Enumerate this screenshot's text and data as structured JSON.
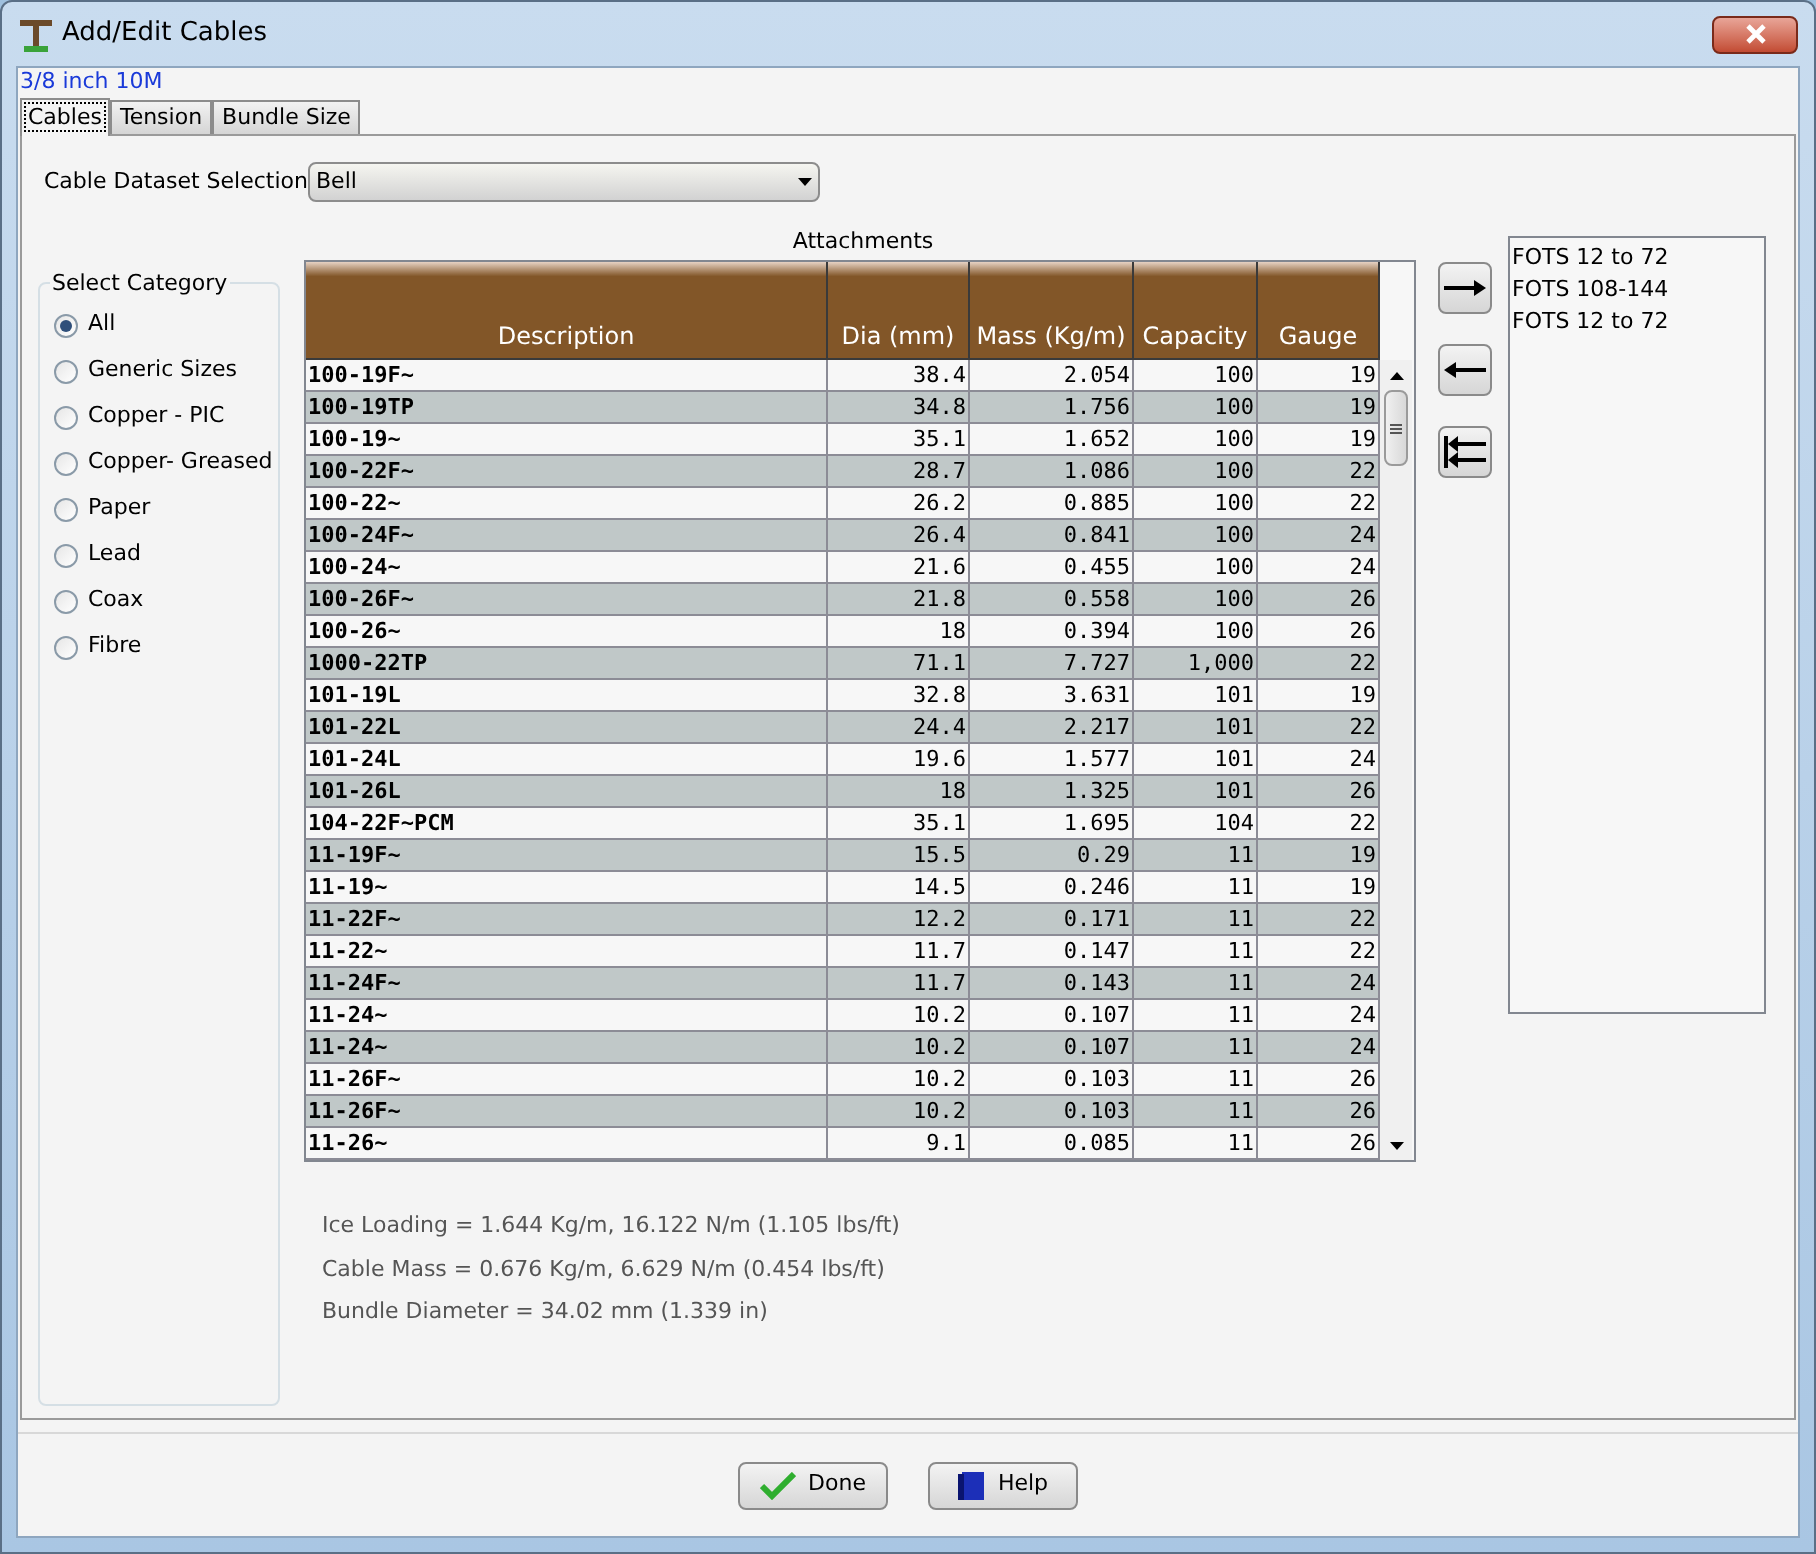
{
  "window": {
    "title": "Add/Edit Cables",
    "subtitle": "3/8 inch 10M"
  },
  "tabs": [
    {
      "label": "Cables",
      "selected": true
    },
    {
      "label": "Tension",
      "selected": false
    },
    {
      "label": "Bundle Size",
      "selected": false
    }
  ],
  "dataset": {
    "label": "Cable Dataset Selection",
    "value": "Bell"
  },
  "attachments_label": "Attachments",
  "category": {
    "title": "Select Category",
    "options": [
      {
        "label": "All",
        "selected": true
      },
      {
        "label": "Generic Sizes",
        "selected": false
      },
      {
        "label": "Copper - PIC",
        "selected": false
      },
      {
        "label": "Copper- Greased",
        "selected": false
      },
      {
        "label": "Paper",
        "selected": false
      },
      {
        "label": "Lead",
        "selected": false
      },
      {
        "label": "Coax",
        "selected": false
      },
      {
        "label": "Fibre",
        "selected": false
      }
    ]
  },
  "table": {
    "columns": [
      "Description",
      "Dia (mm)",
      "Mass (Kg/m)",
      "Capacity",
      "Gauge"
    ],
    "rows": [
      [
        "100-19F~",
        "38.4",
        "2.054",
        "100",
        "19"
      ],
      [
        "100-19TP",
        "34.8",
        "1.756",
        "100",
        "19"
      ],
      [
        "100-19~",
        "35.1",
        "1.652",
        "100",
        "19"
      ],
      [
        "100-22F~",
        "28.7",
        "1.086",
        "100",
        "22"
      ],
      [
        "100-22~",
        "26.2",
        "0.885",
        "100",
        "22"
      ],
      [
        "100-24F~",
        "26.4",
        "0.841",
        "100",
        "24"
      ],
      [
        "100-24~",
        "21.6",
        "0.455",
        "100",
        "24"
      ],
      [
        "100-26F~",
        "21.8",
        "0.558",
        "100",
        "26"
      ],
      [
        "100-26~",
        "18",
        "0.394",
        "100",
        "26"
      ],
      [
        "1000-22TP",
        "71.1",
        "7.727",
        "1,000",
        "22"
      ],
      [
        "101-19L",
        "32.8",
        "3.631",
        "101",
        "19"
      ],
      [
        "101-22L",
        "24.4",
        "2.217",
        "101",
        "22"
      ],
      [
        "101-24L",
        "19.6",
        "1.577",
        "101",
        "24"
      ],
      [
        "101-26L",
        "18",
        "1.325",
        "101",
        "26"
      ],
      [
        "104-22F~PCM",
        "35.1",
        "1.695",
        "104",
        "22"
      ],
      [
        "11-19F~",
        "15.5",
        "0.29",
        "11",
        "19"
      ],
      [
        "11-19~",
        "14.5",
        "0.246",
        "11",
        "19"
      ],
      [
        "11-22F~",
        "12.2",
        "0.171",
        "11",
        "22"
      ],
      [
        "11-22~",
        "11.7",
        "0.147",
        "11",
        "22"
      ],
      [
        "11-24F~",
        "11.7",
        "0.143",
        "11",
        "24"
      ],
      [
        "11-24~",
        "10.2",
        "0.107",
        "11",
        "24"
      ],
      [
        "11-24~",
        "10.2",
        "0.107",
        "11",
        "24"
      ],
      [
        "11-26F~",
        "10.2",
        "0.103",
        "11",
        "26"
      ],
      [
        "11-26F~",
        "10.2",
        "0.103",
        "11",
        "26"
      ],
      [
        "11-26~",
        "9.1",
        "0.085",
        "11",
        "26"
      ]
    ]
  },
  "attachments": [
    "FOTS 12 to 72",
    "FOTS 108-144",
    "FOTS 12 to 72"
  ],
  "info": [
    "Ice Loading = 1.644 Kg/m, 16.122 N/m (1.105 lbs/ft)",
    "Cable Mass = 0.676 Kg/m, 6.629 N/m (0.454 lbs/ft)",
    "Bundle Diameter = 34.02 mm (1.339 in)"
  ],
  "buttons": [
    {
      "kind": "done",
      "label": "Done"
    },
    {
      "kind": "help",
      "label": "Help"
    }
  ]
}
